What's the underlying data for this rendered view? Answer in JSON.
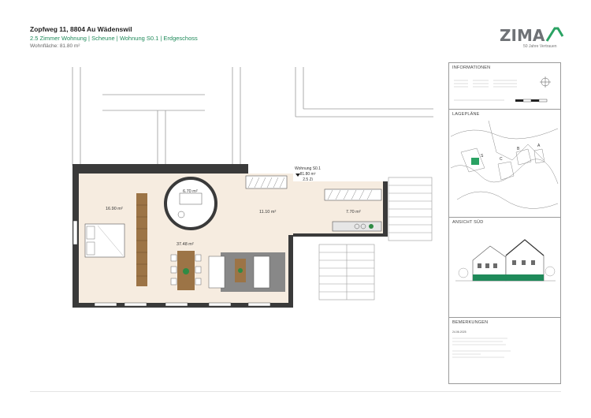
{
  "header": {
    "address": "Zopfweg 11, 8804 Au Wädenswil",
    "unit": "2.5 Zimmer Wohnung | Scheune | Wohnung S0.1 | Erdgeschoss",
    "area": "Wohnfläche: 81.80 m²"
  },
  "logo": {
    "brand_main": "ZIMA",
    "tagline": "50 Jahre Vertrauen"
  },
  "sidebar": {
    "info_title": "INFORMATIONEN",
    "lageplan_title": "LAGEPLÄNE",
    "ansicht_title": "ANSICHT SÜD",
    "bemerkungen_title": "BEMERKUNGEN",
    "bemerkungen_date": "24.06.2025",
    "site_labels": [
      "A",
      "B",
      "C",
      "S"
    ]
  },
  "plan": {
    "unit_label": "Wohnung S0.1",
    "unit_area": "81.80 m²",
    "unit_rooms": "2.5 Zi",
    "rooms": [
      {
        "area": "16.90 m²"
      },
      {
        "area": "6.70 m²"
      },
      {
        "area": "11.10 m²"
      },
      {
        "area": "7.70 m²"
      },
      {
        "area": "37.48 m²"
      }
    ]
  },
  "colors": {
    "accent": "#1f8a5a",
    "floor": "#f6ece0",
    "wall": "#3a3a3a",
    "wood": "#9c7446"
  }
}
